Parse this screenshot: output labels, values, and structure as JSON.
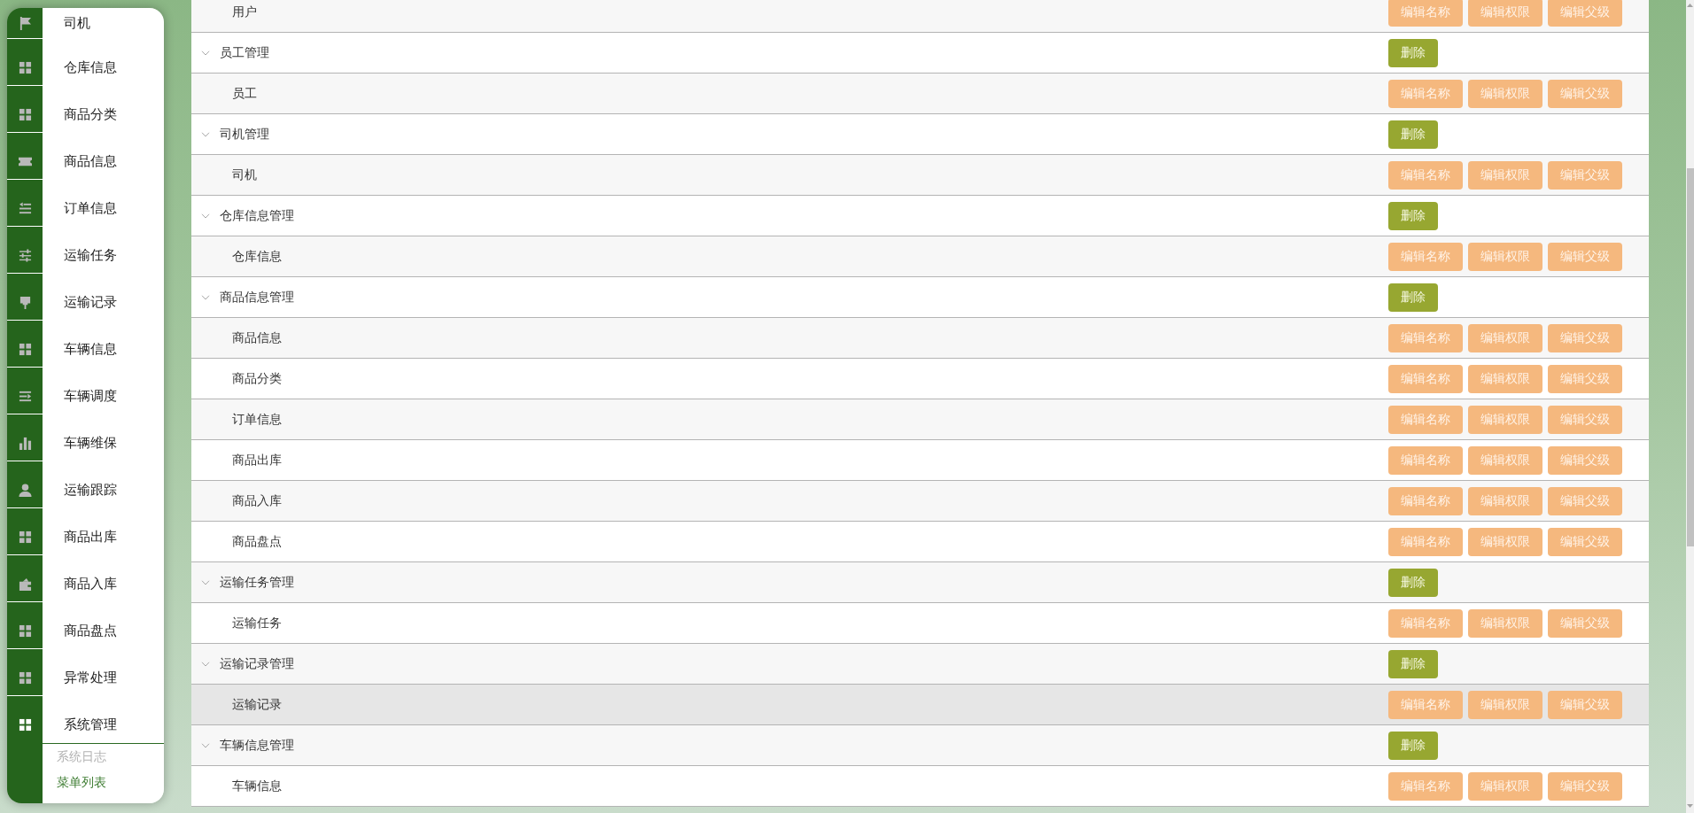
{
  "sidebar": {
    "items": [
      {
        "label": "司机",
        "expanded": false
      },
      {
        "label": "仓库信息",
        "expanded": false
      },
      {
        "label": "商品分类",
        "expanded": false
      },
      {
        "label": "商品信息",
        "expanded": false
      },
      {
        "label": "订单信息",
        "expanded": false
      },
      {
        "label": "运输任务",
        "expanded": false
      },
      {
        "label": "运输记录",
        "expanded": false
      },
      {
        "label": "车辆信息",
        "expanded": false
      },
      {
        "label": "车辆调度",
        "expanded": false
      },
      {
        "label": "车辆维保",
        "expanded": false
      },
      {
        "label": "运输跟踪",
        "expanded": false
      },
      {
        "label": "商品出库",
        "expanded": false
      },
      {
        "label": "商品入库",
        "expanded": false
      },
      {
        "label": "商品盘点",
        "expanded": false
      },
      {
        "label": "异常处理",
        "expanded": false
      },
      {
        "label": "系统管理",
        "expanded": true,
        "children": [
          {
            "label": "系统日志",
            "selected": false
          },
          {
            "label": "菜单列表",
            "selected": true
          }
        ]
      }
    ]
  },
  "menu_table": {
    "rows": [
      {
        "children": [
          {
            "name": "用户",
            "hovered": false,
            "actions": [
              {
                "label": "编辑名称",
                "kind": "edit"
              },
              {
                "label": "编辑权限",
                "kind": "edit"
              },
              {
                "label": "编辑父级",
                "kind": "edit"
              }
            ]
          }
        ]
      },
      {
        "name": "员工管理",
        "expanded": true,
        "hovered": false,
        "actions": [
          {
            "label": "删除",
            "kind": "delete"
          }
        ],
        "children": [
          {
            "name": "员工",
            "hovered": false,
            "actions": [
              {
                "label": "编辑名称",
                "kind": "edit"
              },
              {
                "label": "编辑权限",
                "kind": "edit"
              },
              {
                "label": "编辑父级",
                "kind": "edit"
              }
            ]
          }
        ]
      },
      {
        "name": "司机管理",
        "expanded": true,
        "hovered": false,
        "actions": [
          {
            "label": "删除",
            "kind": "delete"
          }
        ],
        "children": [
          {
            "name": "司机",
            "hovered": false,
            "actions": [
              {
                "label": "编辑名称",
                "kind": "edit"
              },
              {
                "label": "编辑权限",
                "kind": "edit"
              },
              {
                "label": "编辑父级",
                "kind": "edit"
              }
            ]
          }
        ]
      },
      {
        "name": "仓库信息管理",
        "expanded": true,
        "hovered": false,
        "actions": [
          {
            "label": "删除",
            "kind": "delete"
          }
        ],
        "children": [
          {
            "name": "仓库信息",
            "hovered": false,
            "actions": [
              {
                "label": "编辑名称",
                "kind": "edit"
              },
              {
                "label": "编辑权限",
                "kind": "edit"
              },
              {
                "label": "编辑父级",
                "kind": "edit"
              }
            ]
          }
        ]
      },
      {
        "name": "商品信息管理",
        "expanded": true,
        "hovered": false,
        "actions": [
          {
            "label": "删除",
            "kind": "delete"
          }
        ],
        "children": [
          {
            "name": "商品信息",
            "hovered": false,
            "actions": [
              {
                "label": "编辑名称",
                "kind": "edit"
              },
              {
                "label": "编辑权限",
                "kind": "edit"
              },
              {
                "label": "编辑父级",
                "kind": "edit"
              }
            ]
          },
          {
            "name": "商品分类",
            "hovered": false,
            "actions": [
              {
                "label": "编辑名称",
                "kind": "edit"
              },
              {
                "label": "编辑权限",
                "kind": "edit"
              },
              {
                "label": "编辑父级",
                "kind": "edit"
              }
            ]
          },
          {
            "name": "订单信息",
            "hovered": false,
            "actions": [
              {
                "label": "编辑名称",
                "kind": "edit"
              },
              {
                "label": "编辑权限",
                "kind": "edit"
              },
              {
                "label": "编辑父级",
                "kind": "edit"
              }
            ]
          },
          {
            "name": "商品出库",
            "hovered": false,
            "actions": [
              {
                "label": "编辑名称",
                "kind": "edit"
              },
              {
                "label": "编辑权限",
                "kind": "edit"
              },
              {
                "label": "编辑父级",
                "kind": "edit"
              }
            ]
          },
          {
            "name": "商品入库",
            "hovered": false,
            "actions": [
              {
                "label": "编辑名称",
                "kind": "edit"
              },
              {
                "label": "编辑权限",
                "kind": "edit"
              },
              {
                "label": "编辑父级",
                "kind": "edit"
              }
            ]
          },
          {
            "name": "商品盘点",
            "hovered": false,
            "actions": [
              {
                "label": "编辑名称",
                "kind": "edit"
              },
              {
                "label": "编辑权限",
                "kind": "edit"
              },
              {
                "label": "编辑父级",
                "kind": "edit"
              }
            ]
          }
        ]
      },
      {
        "name": "运输任务管理",
        "expanded": true,
        "hovered": false,
        "actions": [
          {
            "label": "删除",
            "kind": "delete"
          }
        ],
        "children": [
          {
            "name": "运输任务",
            "hovered": false,
            "actions": [
              {
                "label": "编辑名称",
                "kind": "edit"
              },
              {
                "label": "编辑权限",
                "kind": "edit"
              },
              {
                "label": "编辑父级",
                "kind": "edit"
              }
            ]
          }
        ]
      },
      {
        "name": "运输记录管理",
        "expanded": true,
        "hovered": false,
        "actions": [
          {
            "label": "删除",
            "kind": "delete"
          }
        ],
        "children": [
          {
            "name": "运输记录",
            "hovered": true,
            "actions": [
              {
                "label": "编辑名称",
                "kind": "edit"
              },
              {
                "label": "编辑权限",
                "kind": "edit"
              },
              {
                "label": "编辑父级",
                "kind": "edit"
              }
            ]
          }
        ]
      },
      {
        "name": "车辆信息管理",
        "expanded": true,
        "hovered": false,
        "actions": [
          {
            "label": "删除",
            "kind": "delete"
          }
        ],
        "children": [
          {
            "name": "车辆信息",
            "hovered": false,
            "actions": [
              {
                "label": "编辑名称",
                "kind": "edit"
              },
              {
                "label": "编辑权限",
                "kind": "edit"
              },
              {
                "label": "编辑父级",
                "kind": "edit"
              }
            ]
          }
        ]
      }
    ]
  }
}
